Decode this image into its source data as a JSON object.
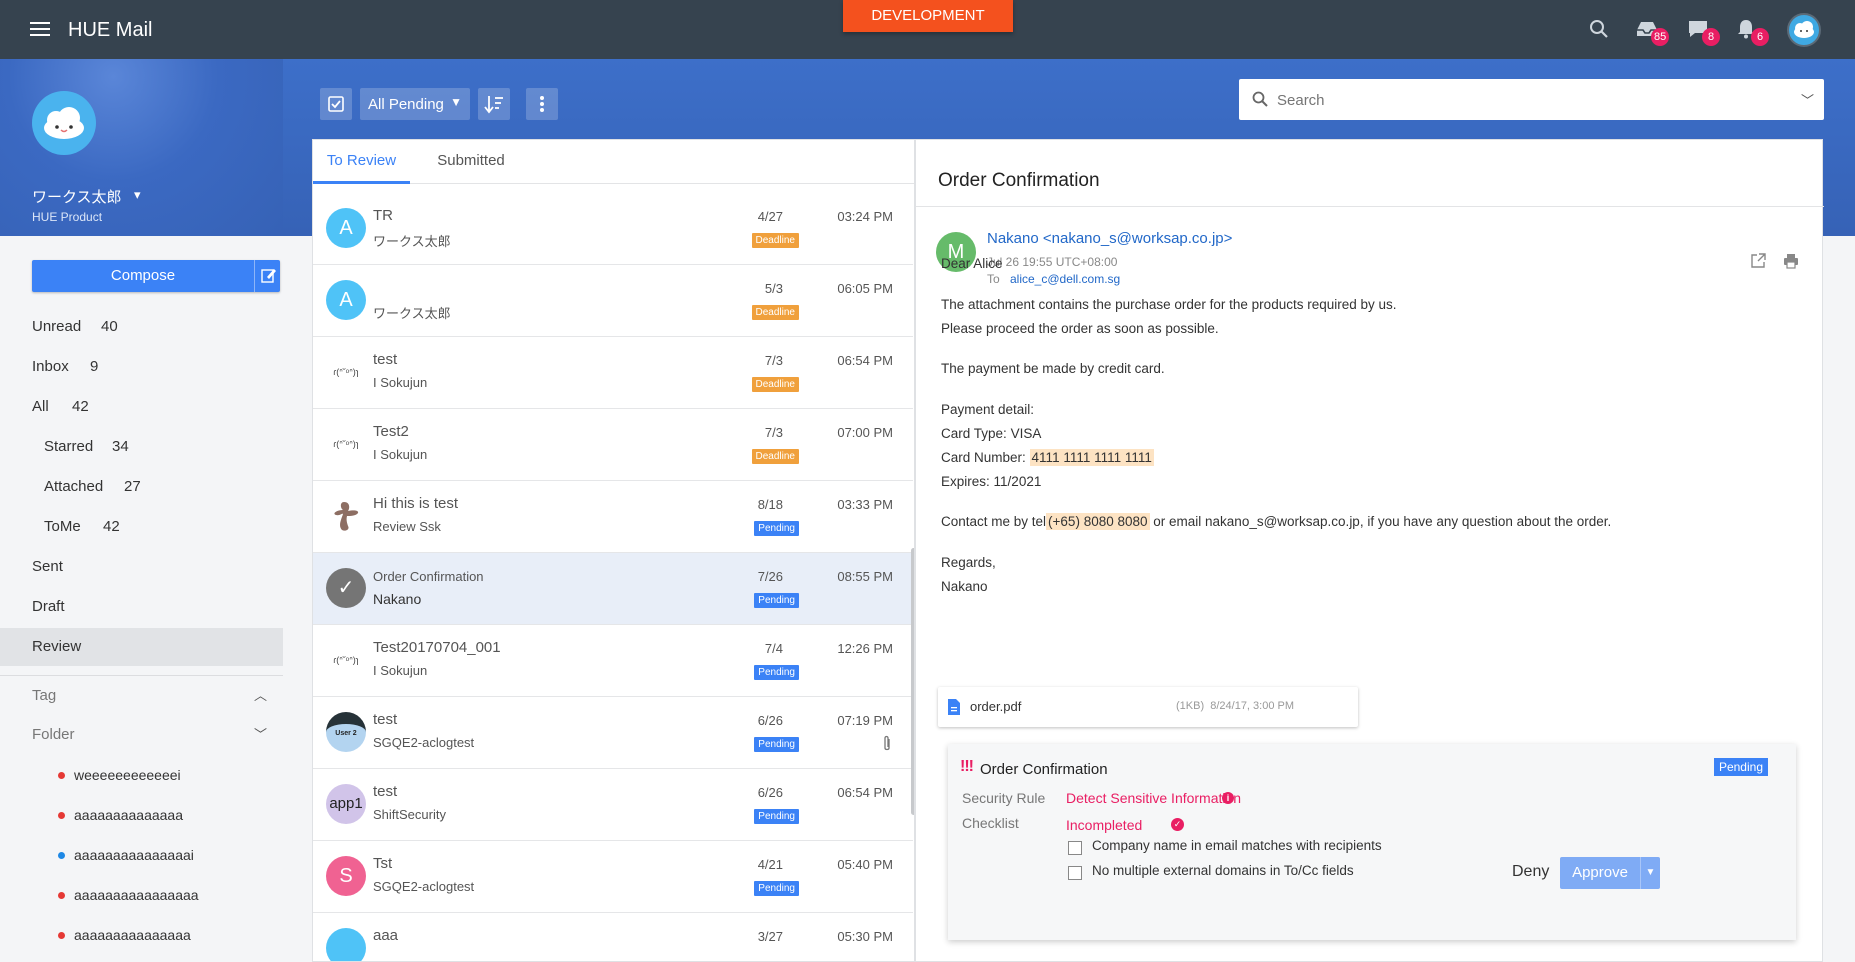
{
  "app": {
    "title": "HUE Mail",
    "env_tag": "DEVELOPMENT"
  },
  "topbar": {
    "mail_badge": "85",
    "chat_badge": "8",
    "notif_badge": "6"
  },
  "user": {
    "name": "ワークス太郎",
    "dept": "HUE Product"
  },
  "compose": {
    "label": "Compose"
  },
  "nav": [
    {
      "label": "Unread",
      "count": "40"
    },
    {
      "label": "Inbox",
      "count": "9"
    },
    {
      "label": "All",
      "count": "42"
    },
    {
      "label": "Starred",
      "count": "34"
    },
    {
      "label": "Attached",
      "count": "27"
    },
    {
      "label": "ToMe",
      "count": "42"
    },
    {
      "label": "Sent",
      "count": ""
    },
    {
      "label": "Draft",
      "count": ""
    },
    {
      "label": "Review",
      "count": ""
    }
  ],
  "sections": {
    "tag": "Tag",
    "folder": "Folder"
  },
  "folders": [
    {
      "name": "weeeeeeeeeeeei",
      "color": "#e53935"
    },
    {
      "name": "aaaaaaaaaaaaaa",
      "color": "#e53935"
    },
    {
      "name": "aaaaaaaaaaaaaaai",
      "color": "#1e88e5"
    },
    {
      "name": "aaaaaaaaaaaaaaaa",
      "color": "#e53935"
    },
    {
      "name": "aaaaaaaaaaaaaaa",
      "color": "#e53935"
    }
  ],
  "toolbar": {
    "filter_label": "All Pending"
  },
  "search": {
    "placeholder": "Search"
  },
  "tabs": [
    "To Review",
    "Submitted"
  ],
  "messages": [
    {
      "subject": "TR",
      "from": "ワークス太郎",
      "date": "4/27",
      "time": "03:24 PM",
      "status": "Deadline",
      "avatar_text": "A",
      "avatar_color": "#4fc3f7"
    },
    {
      "subject": "",
      "from": "ワークス太郎",
      "date": "5/3",
      "time": "06:05 PM",
      "status": "Deadline",
      "avatar_text": "A",
      "avatar_color": "#4fc3f7"
    },
    {
      "subject": "test",
      "from": "I Sokujun",
      "date": "7/3",
      "time": "06:54 PM",
      "status": "Deadline",
      "avatar_text": "ɾ(ᐢ˘ᵒᐢ)ɿ",
      "avatar_color": "#ffffff"
    },
    {
      "subject": "Test2",
      "from": "I Sokujun",
      "date": "7/3",
      "time": "07:00 PM",
      "status": "Deadline",
      "avatar_text": "ɾ(ᐢ˘ᵒᐢ)ɿ",
      "avatar_color": "#ffffff"
    },
    {
      "subject": "Hi this is test",
      "from": "Review Ssk",
      "date": "8/18",
      "time": "03:33 PM",
      "status": "Pending",
      "avatar_text": "",
      "avatar_color": "#ffffff"
    },
    {
      "subject": "Order Confirmation",
      "from": "Nakano",
      "date": "7/26",
      "time": "08:55 PM",
      "status": "Pending",
      "avatar_text": "✓",
      "avatar_color": "#757575"
    },
    {
      "subject": "Test20170704_001",
      "from": "I Sokujun",
      "date": "7/4",
      "time": "12:26 PM",
      "status": "Pending",
      "avatar_text": "ɾ(ᐢ˘ᵒᐢ)ɿ",
      "avatar_color": "#ffffff"
    },
    {
      "subject": "test",
      "from": "SGQE2-aclogtest",
      "date": "6/26",
      "time": "07:19 PM",
      "status": "Pending",
      "avatar_text": "User 2",
      "avatar_color": "#b3d4f0"
    },
    {
      "subject": "test",
      "from": "ShiftSecurity",
      "date": "6/26",
      "time": "06:54 PM",
      "status": "Pending",
      "avatar_text": "app1",
      "avatar_color": "#d1c4e9"
    },
    {
      "subject": "Tst",
      "from": "SGQE2-aclogtest",
      "date": "4/21",
      "time": "05:40 PM",
      "status": "Pending",
      "avatar_text": "S",
      "avatar_color": "#f06292"
    },
    {
      "subject": "aaa",
      "from": "",
      "date": "3/27",
      "time": "05:30 PM",
      "status": "",
      "avatar_text": "",
      "avatar_color": "#4fc3f7"
    }
  ],
  "reader": {
    "title": "Order Confirmation",
    "avatar_letter": "M",
    "sender": "Nakano <nakano_s@worksap.co.jp>",
    "date": "Jul 26 19:55 UTC+08:00",
    "to_label": "To",
    "to": "alice_c@dell.com.sg",
    "body": {
      "greeting": "Dear Alice",
      "line1": "The attachment contains the purchase order for the products required by us.",
      "line2": "Please proceed the order as soon as possible.",
      "line3": "The payment be made by credit card.",
      "line4": "Payment detail:",
      "card_type_label": "Card Type:",
      "card_type": "VISA",
      "card_number_label": "Card Number:",
      "card_number": "4111 1111 1111 1111",
      "expires_label": "Expires:",
      "expires": "11/2021",
      "contact_pre": "Contact me by tel",
      "phone": "(+65) 8080 8080",
      "contact_post": " or email nakano_s@worksap.co.jp, if you have any question about the order.",
      "regards": "Regards,",
      "signature": "Nakano"
    },
    "attachment": {
      "name": "order.pdf",
      "meta": "(1KB)  8/24/17, 3:00 PM"
    }
  },
  "review": {
    "marks": "!!!",
    "title": "Order Confirmation",
    "status": "Pending",
    "security_label": "Security Rule",
    "security_value": "Detect Sensitive Information",
    "checklist_label": "Checklist",
    "checklist_status": "Incompleted",
    "items": [
      "Company name in email matches with recipients",
      "No multiple external domains in To/Cc fields"
    ],
    "deny": "Deny",
    "approve": "Approve"
  },
  "colors": {
    "accent": "#3b82f6",
    "topbar": "#36434f",
    "deadline": "#f0a03c",
    "danger": "#e91e63",
    "dev": "#f4511e"
  }
}
